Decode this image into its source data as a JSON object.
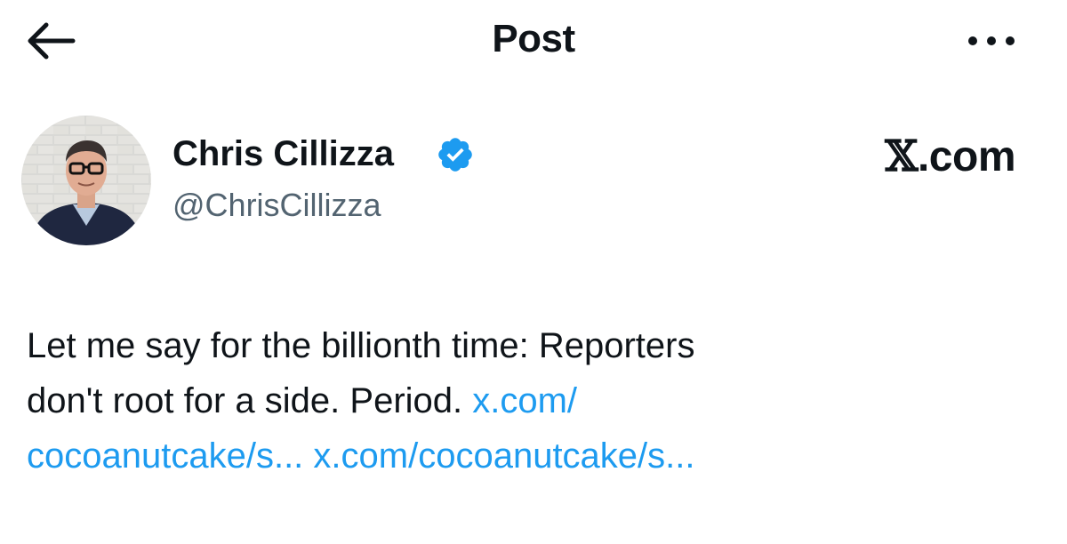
{
  "header": {
    "title": "Post",
    "back_icon": "arrow-left-icon",
    "more_icon": "more-horizontal-icon"
  },
  "author": {
    "display_name": "Chris Cillizza",
    "handle": "@ChrisCillizza",
    "verified_icon": "verified-badge-icon",
    "verified_color": "#1d9bf0"
  },
  "watermark": {
    "x_letter": "𝕏",
    "suffix": ".com"
  },
  "post": {
    "line1": "Let me say for the billionth time: Reporters",
    "line2_text": "don't root for a side. Period. ",
    "link1_part1": "x.com/",
    "link1_part2": "cocoanutcake/s...",
    "link2": "x.com/cocoanutcake/s..."
  },
  "colors": {
    "text": "#0f1419",
    "secondary": "#536471",
    "link": "#1d9bf0"
  }
}
